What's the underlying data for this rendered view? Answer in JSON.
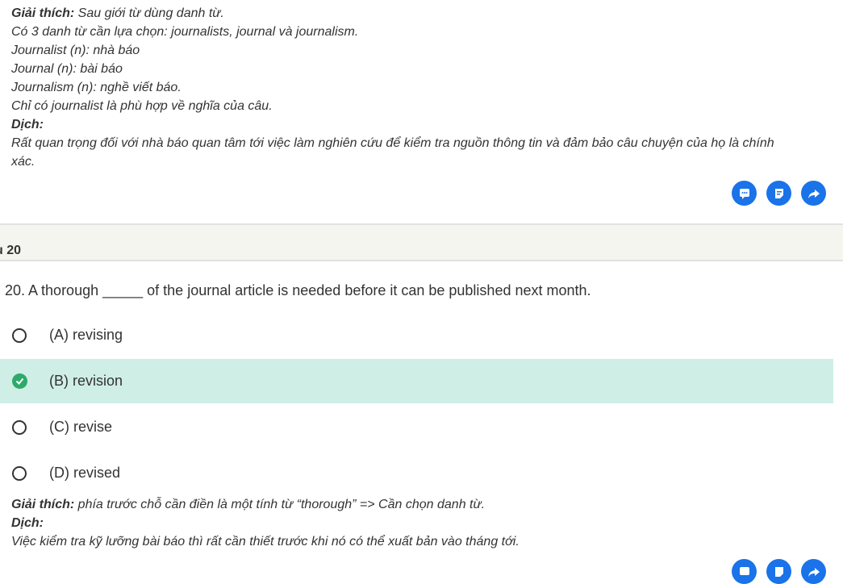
{
  "top_explanation": {
    "heading": "Giải thích:",
    "heading_text": " Sau giới từ dùng danh từ.",
    "lines": [
      "Có 3 danh từ cần lựa chọn: journalists, journal và journalism.",
      "Journalist (n): nhà báo",
      "Journal (n): bài báo",
      "Journalism (n): nghề viết báo.",
      "Chỉ có journalist là phù hợp về nghĩa của câu."
    ],
    "translation_heading": "Dịch:",
    "translation_line1": "Rất quan trọng đối với nhà báo quan tâm tới việc làm nghiên cứu để kiểm tra nguồn thông tin và đảm bảo câu chuyện của họ là chính",
    "translation_line2": "xác."
  },
  "actions": {
    "icons": [
      "comment-icon",
      "note-icon",
      "share-icon"
    ],
    "color": "#1a73e8"
  },
  "question_header": {
    "label": "u 20"
  },
  "question": {
    "text": "20. A thorough _____ of the journal article is needed before it can be published next month."
  },
  "options": [
    {
      "label": "(A) revising",
      "selected": false
    },
    {
      "label": "(B) revision",
      "selected": true
    },
    {
      "label": "(C) revise",
      "selected": false
    },
    {
      "label": "(D) revised",
      "selected": false
    }
  ],
  "bottom_explanation": {
    "heading": "Giải thích:",
    "heading_text": " phía trước chỗ cần điền là một tính từ “thorough” => Cần chọn danh từ.",
    "translation_heading": "Dịch:",
    "translation": "Việc kiểm tra kỹ lưỡng bài báo thì rất cần thiết trước khi nó có thể xuất bản vào tháng tới."
  },
  "colors": {
    "accent": "#1a73e8",
    "selected_bg": "#cfeee6",
    "check": "#2eaa6b"
  }
}
